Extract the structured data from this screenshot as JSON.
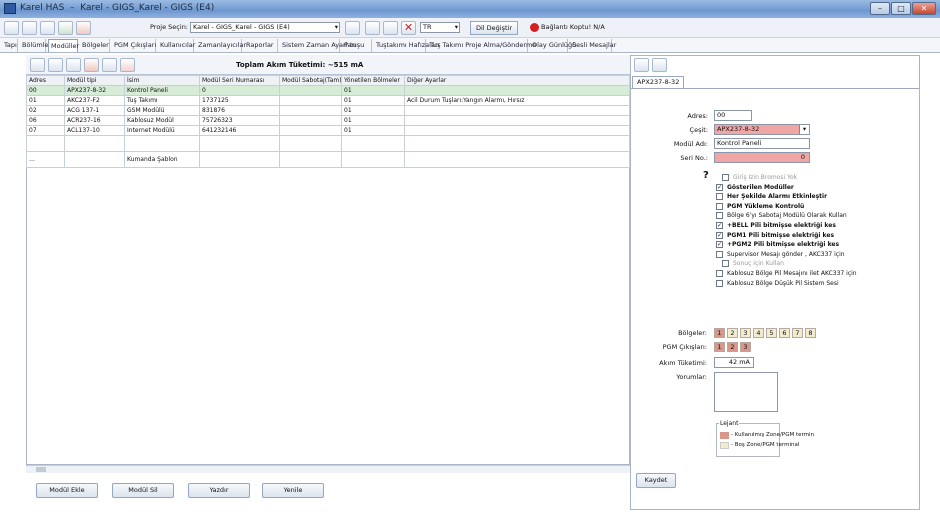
{
  "window": {
    "title": "Karel HAS",
    "doc": "Karel - GIGS_Karel - GIGS (E4)"
  },
  "toolbar": {
    "project_label": "Proje Seçin:",
    "project_value": "Karel - GIGS_Karel - GIGS (E4)",
    "lang": "TR",
    "change_lang": "Dil Değiştir",
    "connection": "Bağlantı Koptu! N/A"
  },
  "tabs": [
    "Tapı",
    "Bölümler",
    "Modüller",
    "Bölgeler",
    "PGM Çıkışları",
    "Kullanıcılar",
    "Zamanlayıcılar",
    "Raporlar",
    "Sistem Zaman Ayarları",
    "P-tuşu",
    "Tuştakımı Hafızaları",
    "Tuş Takımı Proje Alma/Gönderme",
    "Olay Günlüğü",
    "Sesli Mesajlar"
  ],
  "grid": {
    "title": "Toplam Akım Tüketimi: ~515 mA",
    "columns": [
      "Adres",
      "Modül tipi",
      "İsim",
      "Modül Seri Numarası",
      "Modül Sabotaj(Tam)",
      "Yönetilen Bölmeler",
      "Diğer Ayarlar"
    ],
    "rows": [
      [
        "00",
        "APX237-8-32",
        "Kontrol Paneli",
        "0",
        "",
        "01",
        ""
      ],
      [
        "01",
        "AKC237-F2",
        "Tuş Takımı",
        "1737125",
        "",
        "01",
        "Acil Durum Tuşları:Yangın Alarmı, Hırsız"
      ],
      [
        "02",
        "ACG 137-1",
        "GSM Modülü",
        "831876",
        "",
        "01",
        ""
      ],
      [
        "06",
        "ACR237-16",
        "Kablosuz Modül",
        "75726323",
        "",
        "01",
        ""
      ],
      [
        "07",
        "ACL137-10",
        "Internet Modülü",
        "641232146",
        "",
        "01",
        ""
      ],
      [
        "",
        "",
        "",
        "",
        "",
        "",
        ""
      ],
      [
        "…",
        "",
        "Kumanda Şablon",
        "",
        "",
        "",
        ""
      ]
    ]
  },
  "buttons": {
    "add": "Modül Ekle",
    "delete": "Modül Sil",
    "print": "Yazdır",
    "refresh": "Yenile",
    "save": "Kaydet"
  },
  "right": {
    "tab": "APX237-8-32",
    "address_label": "Adres:",
    "address": "00",
    "type_label": "Çeşit:",
    "type": "APX237-8-32",
    "name_label": "Modül Adı:",
    "name": "Kontrol Paneli",
    "serial_label": "Seri No.:",
    "serial": "0",
    "checks": [
      {
        "label": "Giriş Izin Bromosi Yok",
        "checked": false,
        "dim": true,
        "bold": false
      },
      {
        "label": "Gösterilen Modüller",
        "checked": true,
        "dim": false,
        "bold": true
      },
      {
        "label": "Her Şekilde Alarmı Etkinleştir",
        "checked": false,
        "dim": false,
        "bold": true
      },
      {
        "label": "PGM Yükleme Kontrolü",
        "checked": false,
        "dim": false,
        "bold": true
      },
      {
        "label": "Bölge 6'yı Sabotaj Modülü Olarak Kullan",
        "checked": false,
        "dim": false,
        "bold": false
      },
      {
        "label": "+BELL Pili bitmişse elektriği kes",
        "checked": true,
        "dim": false,
        "bold": true
      },
      {
        "label": "PGM1 Pili bitmişse elektriği kes",
        "checked": true,
        "dim": false,
        "bold": true
      },
      {
        "label": "+PGM2 Pili bitmişse elektriği kes",
        "checked": true,
        "dim": false,
        "bold": true
      },
      {
        "label": "Supervisor Mesajı gönder , AKC337 için",
        "checked": false,
        "dim": false,
        "bold": false
      },
      {
        "label": "Sonuç için Kullan",
        "checked": false,
        "dim": true,
        "bold": false
      },
      {
        "label": "Kablosuz Bölge Pil Mesajını ilet AKC337 için",
        "checked": false,
        "dim": false,
        "bold": false
      },
      {
        "label": "Kablosuz Bölge Düşük Pil Sistem Sesi",
        "checked": false,
        "dim": false,
        "bold": false
      }
    ],
    "zones_label": "Bölgeler:",
    "zones": [
      "1",
      "2",
      "3",
      "4",
      "5",
      "6",
      "7",
      "8"
    ],
    "zones_used": 1,
    "pgm_label": "PGM Çıkışları:",
    "pgm": [
      "1",
      "2",
      "3"
    ],
    "current_label": "Akım Tüketimi:",
    "current": "42 mA",
    "comments_label": "Yorumlar:",
    "legend_title": "Lejant",
    "legend": [
      "- Kullanılmış Zone/PGM termin",
      "- Boş Zone/PGM terminal"
    ],
    "help_mark": "?"
  },
  "colors": {
    "used": "#d9968a",
    "free": "#f2eccf",
    "selected_row": "#d7ecd7",
    "pink": "#f1a6a6"
  }
}
